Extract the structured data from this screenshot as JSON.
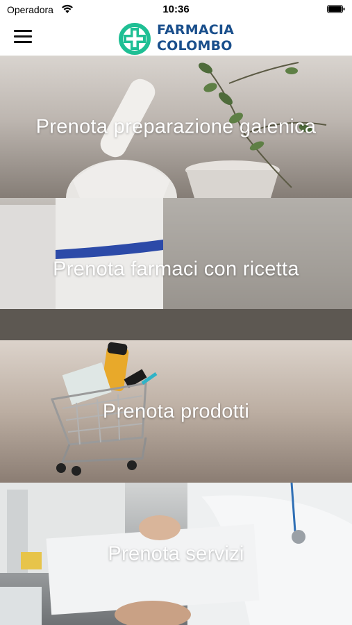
{
  "status_bar": {
    "carrier": "Operadora",
    "time": "10:36"
  },
  "header": {
    "logo_line1": "FARMACIA",
    "logo_line2": "COLOMBO",
    "brand_color": "#1a4f8c",
    "accent_color": "#1fbf94"
  },
  "panels": [
    {
      "label": "Prenota preparazione galenica",
      "icon": "mortar-pestle-image"
    },
    {
      "label": "Prenota farmaci con ricetta",
      "icon": "medicine-box-image"
    },
    {
      "label": "Prenota prodotti",
      "icon": "shopping-cart-image"
    },
    {
      "label": "Prenota servizi",
      "icon": "doctor-image"
    }
  ]
}
